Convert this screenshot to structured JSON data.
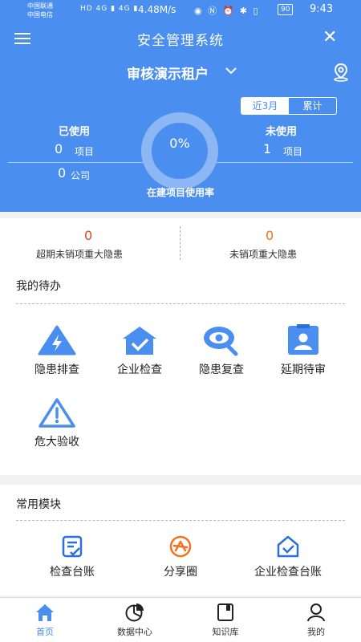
{
  "status_bar": {
    "carrier1": "中国联通",
    "carrier2": "中国电信",
    "network_icons": "HD 4G ▮ 4G ▮",
    "speed": "4.48M/s",
    "right_icons": "◉ Ⓝ ⏰ ✱ ▯",
    "battery": "90",
    "time": "9:43"
  },
  "header": {
    "app_title": "安全管理系统",
    "tenant": "审核演示租户",
    "toggle": {
      "recent": "近3月",
      "total": "累计"
    },
    "used": {
      "label": "已使用",
      "projects": "0",
      "projects_unit": "项目",
      "companies": "0",
      "companies_unit": "公司"
    },
    "unused": {
      "label": "未使用",
      "projects": "1",
      "projects_unit": "项目"
    },
    "usage_rate": {
      "value": "0%",
      "label": "在建项目使用率"
    }
  },
  "stats": {
    "overdue": {
      "value": "0",
      "label": "超期未销项重大隐患"
    },
    "pending": {
      "value": "0",
      "label": "未销项重大隐患"
    }
  },
  "todo": {
    "title": "我的待办",
    "items": [
      {
        "label": "隐患排查",
        "icon": "warning-bolt-icon"
      },
      {
        "label": "企业检查",
        "icon": "house-check-icon"
      },
      {
        "label": "隐患复查",
        "icon": "eye-search-icon"
      },
      {
        "label": "延期待审",
        "icon": "badge-person-icon"
      },
      {
        "label": "危大验收",
        "icon": "warning-triangle-icon"
      }
    ]
  },
  "modules": {
    "title": "常用模块",
    "items": [
      {
        "label": "检查台账",
        "icon": "ledger-icon"
      },
      {
        "label": "分享圈",
        "icon": "share-circle-icon"
      },
      {
        "label": "企业检查台账",
        "icon": "house-ledger-icon"
      }
    ]
  },
  "tabbar": {
    "items": [
      {
        "label": "首页",
        "icon": "home-icon"
      },
      {
        "label": "数据中心",
        "icon": "pie-chart-icon"
      },
      {
        "label": "知识库",
        "icon": "book-icon"
      },
      {
        "label": "我的",
        "icon": "user-icon"
      }
    ]
  },
  "colors": {
    "primary": "#4a8ef0",
    "danger": "#e0452b",
    "warning": "#f0731f"
  }
}
